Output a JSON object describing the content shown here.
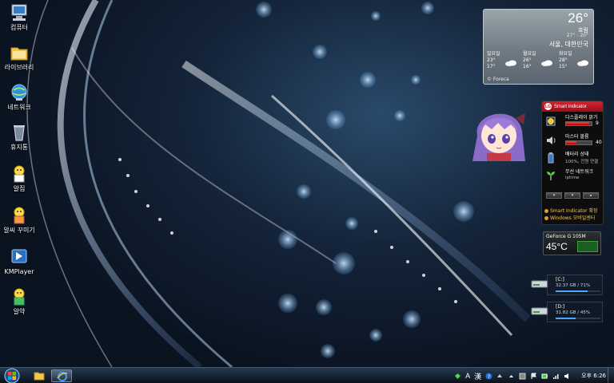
{
  "desktop": {
    "icons": [
      {
        "label": "컴퓨터",
        "icon": "computer-icon"
      },
      {
        "label": "라이브러리",
        "icon": "library-folder-icon"
      },
      {
        "label": "네트워크",
        "icon": "network-globe-icon"
      },
      {
        "label": "휴지통",
        "icon": "recycle-bin-icon"
      },
      {
        "label": "알집",
        "icon": "alzip-icon"
      },
      {
        "label": "알씨 꾸미기",
        "icon": "alsee-icon"
      },
      {
        "label": "KMPlayer",
        "icon": "kmplayer-icon"
      },
      {
        "label": "알약",
        "icon": "alyac-icon"
      }
    ]
  },
  "weather": {
    "temp": "26°",
    "condition": "흐림",
    "hilo": "27° - 20°",
    "city": "서울, 대한민국",
    "days": [
      {
        "name": "일요일",
        "high": "23°",
        "low": "17°"
      },
      {
        "name": "월요일",
        "high": "26°",
        "low": "16°"
      },
      {
        "name": "화요일",
        "high": "28°",
        "low": "15°"
      }
    ],
    "provider": "© Foreca"
  },
  "lg": {
    "title": "Smart Indicator",
    "brand": "LG",
    "brightness": {
      "label": "디스플레이 밝기",
      "value": "9",
      "level": 0.9
    },
    "volume": {
      "label": "마스터 볼륨",
      "value": "40",
      "level": 0.4
    },
    "battery": {
      "label": "배터리 상태",
      "status": "100%, 전원 연결"
    },
    "wireless": {
      "label": "무선 네트워크",
      "ssid": "iptime"
    },
    "links": [
      "Smart Indicator 확장",
      "Windows 모바일센터"
    ]
  },
  "gpu": {
    "name": "GeForce G 105M",
    "temp": "45°C"
  },
  "drives": [
    {
      "letter": "[C:]",
      "info": "32.37 GB / 71%",
      "used": 0.71
    },
    {
      "letter": "[D:]",
      "info": "31.82 GB / 45%",
      "used": 0.45
    }
  ],
  "taskbar": {
    "ime_a": "A",
    "ime_han": "漢",
    "clock": "오후 6:26",
    "colors": {
      "accent": "#2b6fb6"
    }
  }
}
